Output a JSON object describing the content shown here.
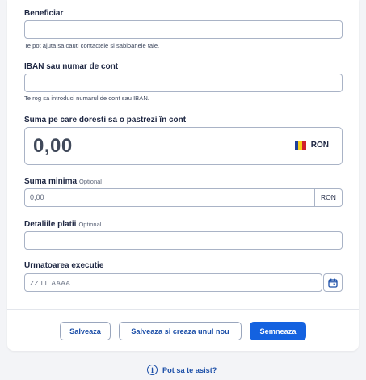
{
  "form": {
    "beneficiar": {
      "label": "Beneficiar",
      "value": "",
      "hint": "Te pot ajuta sa cauti contactele si sabloanele tale."
    },
    "iban": {
      "label": "IBAN sau numar de cont",
      "value": "",
      "hint": "Te rog sa introduci numarul de cont sau IBAN."
    },
    "suma_pastrata": {
      "label": "Suma pe care doresti sa o pastrezi în cont",
      "value": "0,00",
      "currency": "RON"
    },
    "suma_minima": {
      "label": "Suma minima",
      "optional": "Optional",
      "value": "0,00",
      "currency": "RON"
    },
    "detalii": {
      "label": "Detaliile platii",
      "optional": "Optional",
      "value": ""
    },
    "urmatoarea_executie": {
      "label": "Urmatoarea executie",
      "placeholder": "ZZ.LL.AAAA"
    }
  },
  "actions": {
    "save": "Salveaza",
    "save_new": "Salveaza si creaza unul nou",
    "sign": "Semneaza"
  },
  "help": {
    "label": "Pot sa te asist?"
  },
  "flag_colors": [
    "#1f3f9a",
    "#f6cf1a",
    "#d1202d"
  ],
  "icons": {
    "calendar": "calendar-icon",
    "info": "info-icon",
    "flag": "romania-flag-icon"
  }
}
